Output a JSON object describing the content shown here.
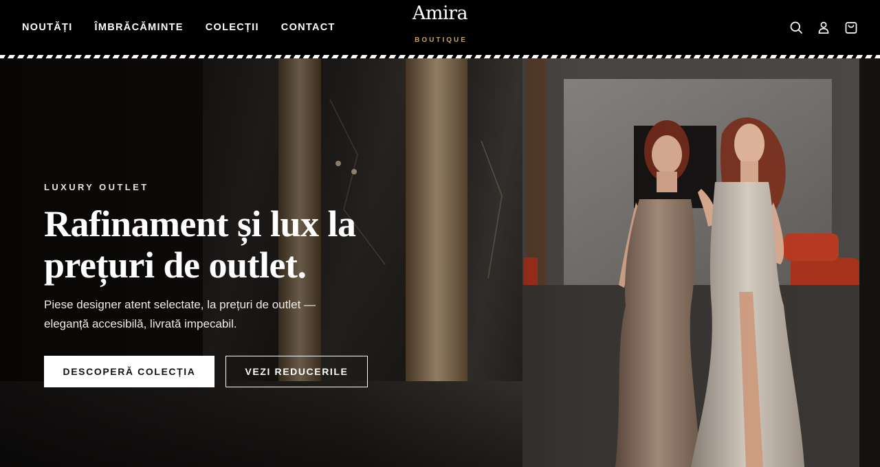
{
  "header": {
    "nav": [
      "NOUTĂȚI",
      "ÎMBRĂCĂMINTE",
      "COLECȚII",
      "CONTACT"
    ],
    "logo_name": "Amira",
    "logo_subtitle": "BOUTIQUE",
    "icons": [
      "search-icon",
      "account-icon",
      "cart-icon"
    ]
  },
  "hero": {
    "eyebrow": "LUXURY OUTLET",
    "headline_line1": "Rafinament și lux la",
    "headline_line2": "prețuri de outlet.",
    "subline_line1": "Piese designer atent selectate, la prețuri de outlet —",
    "subline_line2": "eleganță accesibilă, livrată impecabil.",
    "primary_cta": "DESCOPERĂ COLECȚIA",
    "secondary_cta": "VEZI REDUCERILE"
  },
  "colors": {
    "header_bg": "#000000",
    "logo_accent": "#c9a35a",
    "text": "#ffffff"
  }
}
